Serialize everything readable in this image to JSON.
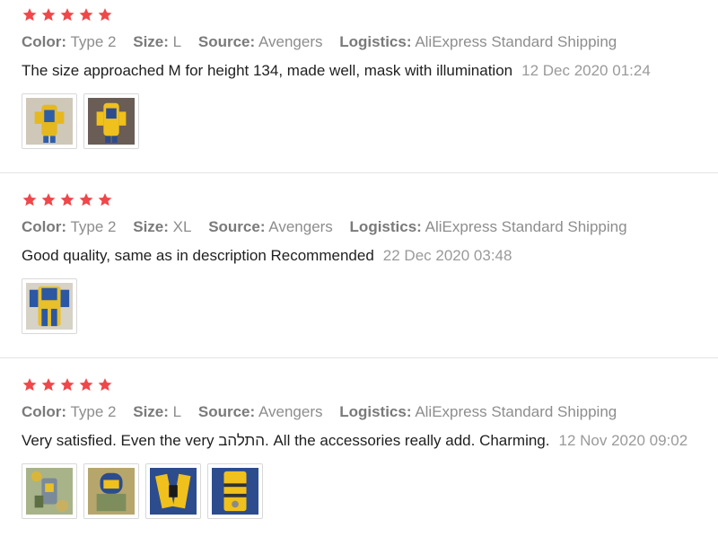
{
  "labels": {
    "color": "Color:",
    "size": "Size:",
    "source": "Source:",
    "logistics": "Logistics:"
  },
  "colors": {
    "star": "#f0474a",
    "divider": "#e4e4e4"
  },
  "reviews": [
    {
      "rating": 5,
      "color": "Type 2",
      "size": "L",
      "source": "Avengers",
      "logistics": "AliExpress Standard Shipping",
      "text": "The size approached M for height 134, made well, mask with illumination",
      "date": "12 Dec 2020 01:24",
      "photos": [
        "review-photo-1",
        "review-photo-2"
      ]
    },
    {
      "rating": 5,
      "color": "Type 2",
      "size": "XL",
      "source": "Avengers",
      "logistics": "AliExpress Standard Shipping",
      "text": "Good quality, same as in description Recommended",
      "date": "22 Dec 2020 03:48",
      "photos": [
        "review-photo-1"
      ]
    },
    {
      "rating": 5,
      "color": "Type 2",
      "size": "L",
      "source": "Avengers",
      "logistics": "AliExpress Standard Shipping",
      "text": "Very satisfied. Even the very התלהב. All the accessories really add. Charming.",
      "date": "12 Nov 2020 09:02",
      "photos": [
        "review-photo-1",
        "review-photo-2",
        "review-photo-3",
        "review-photo-4"
      ]
    }
  ]
}
